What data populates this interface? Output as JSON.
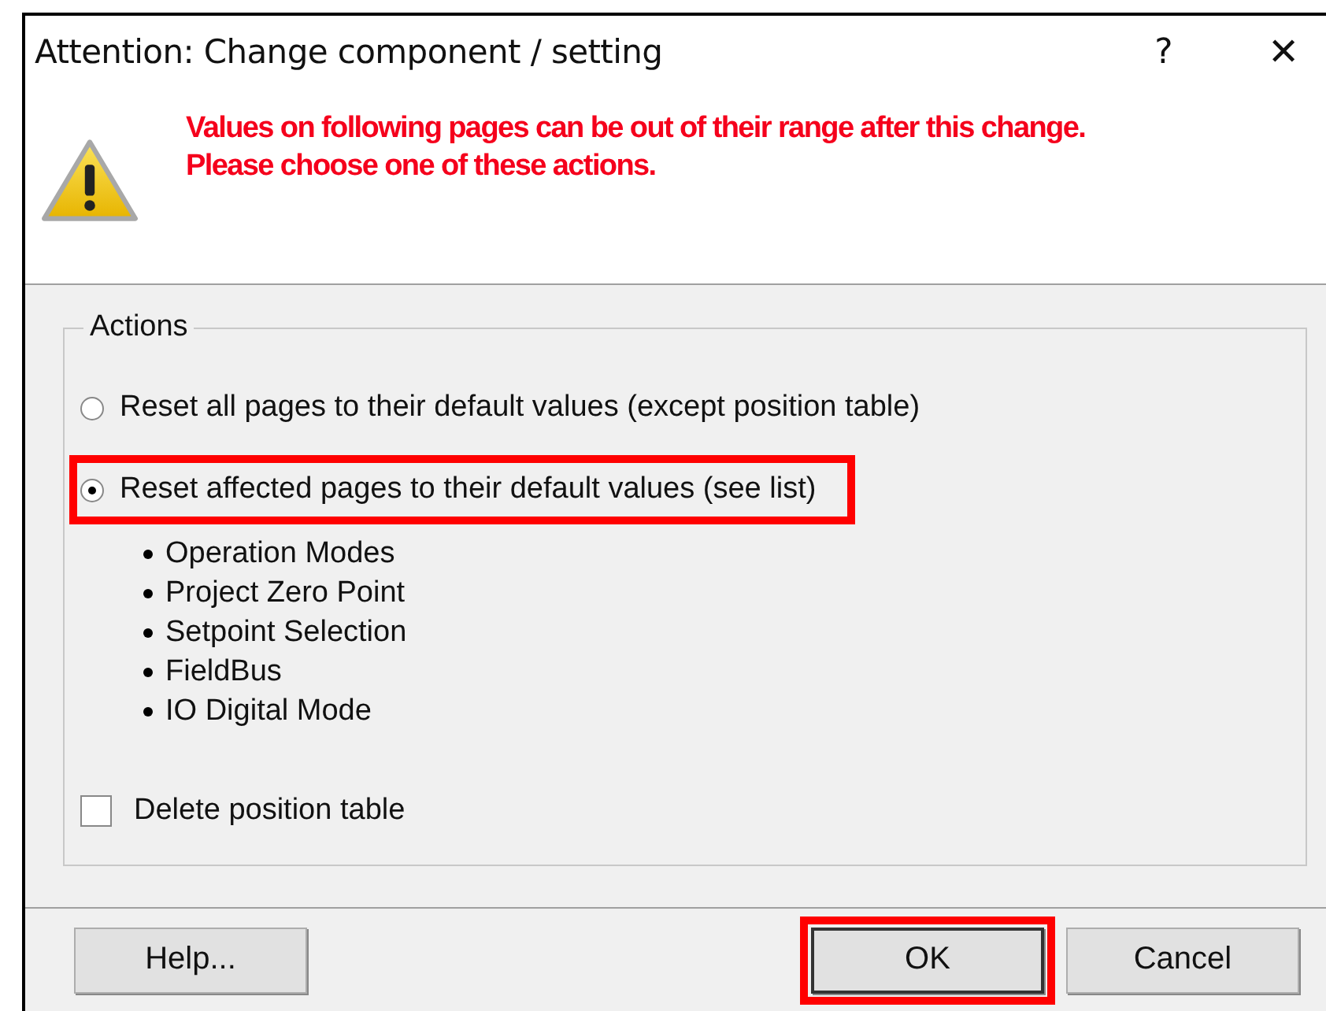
{
  "window": {
    "title": "Attention: Change component / setting",
    "help_glyph": "?",
    "close_glyph": "✕"
  },
  "message": {
    "lines": [
      "Values on following pages can be out of their range after this change.",
      "Please choose one of these actions."
    ]
  },
  "actions": {
    "title": "Actions",
    "options": [
      {
        "label": "Reset all pages to their default values (except position table)",
        "selected": false,
        "highlighted": false
      },
      {
        "label": "Reset affected pages to their default values (see list)",
        "selected": true,
        "highlighted": true
      }
    ],
    "affected_pages": [
      "Operation Modes",
      "Project Zero Point",
      "Setpoint Selection",
      "FieldBus",
      "IO Digital Mode"
    ],
    "delete_position_table": {
      "label": "Delete position table",
      "checked": false
    }
  },
  "buttons": [
    {
      "label": "Help...",
      "highlighted": false,
      "default": false
    },
    {
      "label": "OK",
      "highlighted": true,
      "default": true
    },
    {
      "label": "Cancel",
      "highlighted": false,
      "default": false
    }
  ]
}
